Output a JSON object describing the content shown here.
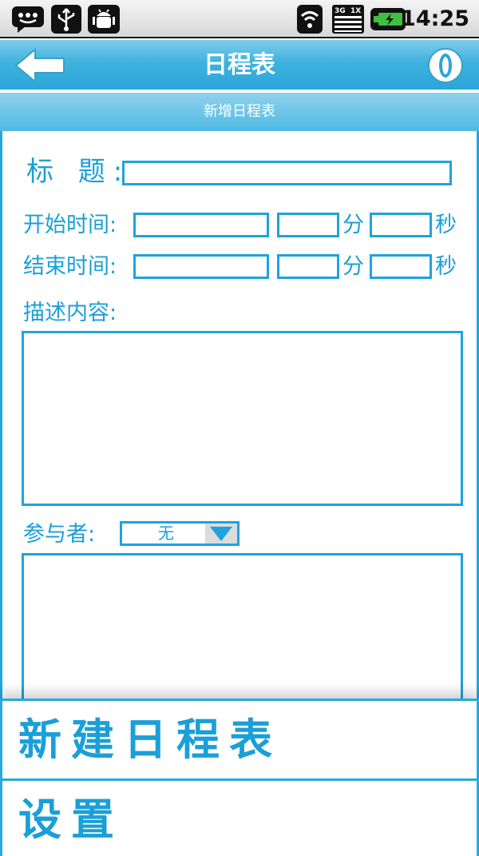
{
  "status_bar": {
    "time": "14:25",
    "icons": [
      "chat-notification-icon",
      "usb-icon",
      "android-debug-icon",
      "wifi-icon",
      "3g-1x-signal-icon",
      "battery-charging-icon"
    ]
  },
  "header": {
    "title": "日程表",
    "back_icon": "arrow-left-icon",
    "info_icon": "info-icon"
  },
  "subheader": {
    "title": "新增日程表"
  },
  "form": {
    "title_label": "标  题:",
    "title_value": "",
    "start_label": "开始时间:",
    "end_label": "结束时间:",
    "minute_unit": "分",
    "second_unit": "秒",
    "description_label": "描述内容:",
    "description_value": "",
    "participants_label": "参与者:",
    "participants_selected": "无"
  },
  "menu": {
    "items": [
      {
        "label": "新建日程表"
      },
      {
        "label": "设置"
      }
    ]
  },
  "colors": {
    "accent": "#1fa3dc",
    "header_top": "#7fcde9",
    "header_bottom": "#2aa6d8",
    "text": "#1c9fd6"
  }
}
